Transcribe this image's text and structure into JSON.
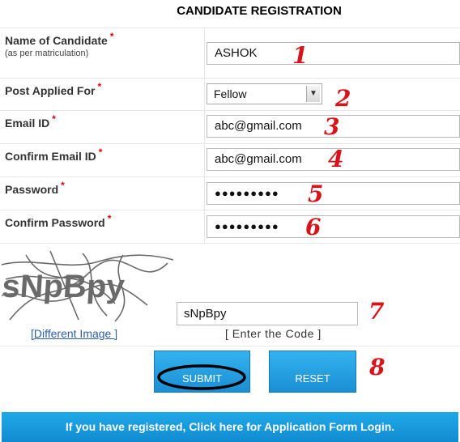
{
  "page": {
    "title": "CANDIDATE REGISTRATION"
  },
  "form": {
    "candidate_name": {
      "label": "Name of Candidate",
      "sub": "(as per matriculation)",
      "value": "ASHOK",
      "marker": "1"
    },
    "post_applied": {
      "label": "Post Applied For",
      "value": "Fellow",
      "marker": "2"
    },
    "email": {
      "label": "Email ID",
      "value": "abc@gmail.com",
      "marker": "3"
    },
    "confirm_email": {
      "label": "Confirm Email ID",
      "value": "abc@gmail.com",
      "marker": "4"
    },
    "password": {
      "label": "Password",
      "value": "●●●●●●●●●",
      "marker": "5"
    },
    "confirm_password": {
      "label": "Confirm Password",
      "value": "●●●●●●●●●",
      "marker": "6"
    },
    "required_mark": "*"
  },
  "captcha": {
    "image_text": "sNpBpy",
    "input_value": "sNpBpy",
    "different_image": "[Different Image ]",
    "hint": "[ Enter the Code ]",
    "marker": "7"
  },
  "buttons": {
    "submit": "SUBMIT",
    "reset": "RESET",
    "marker": "8"
  },
  "login_bar": {
    "text": "If you have registered, Click here for Application Form Login."
  }
}
